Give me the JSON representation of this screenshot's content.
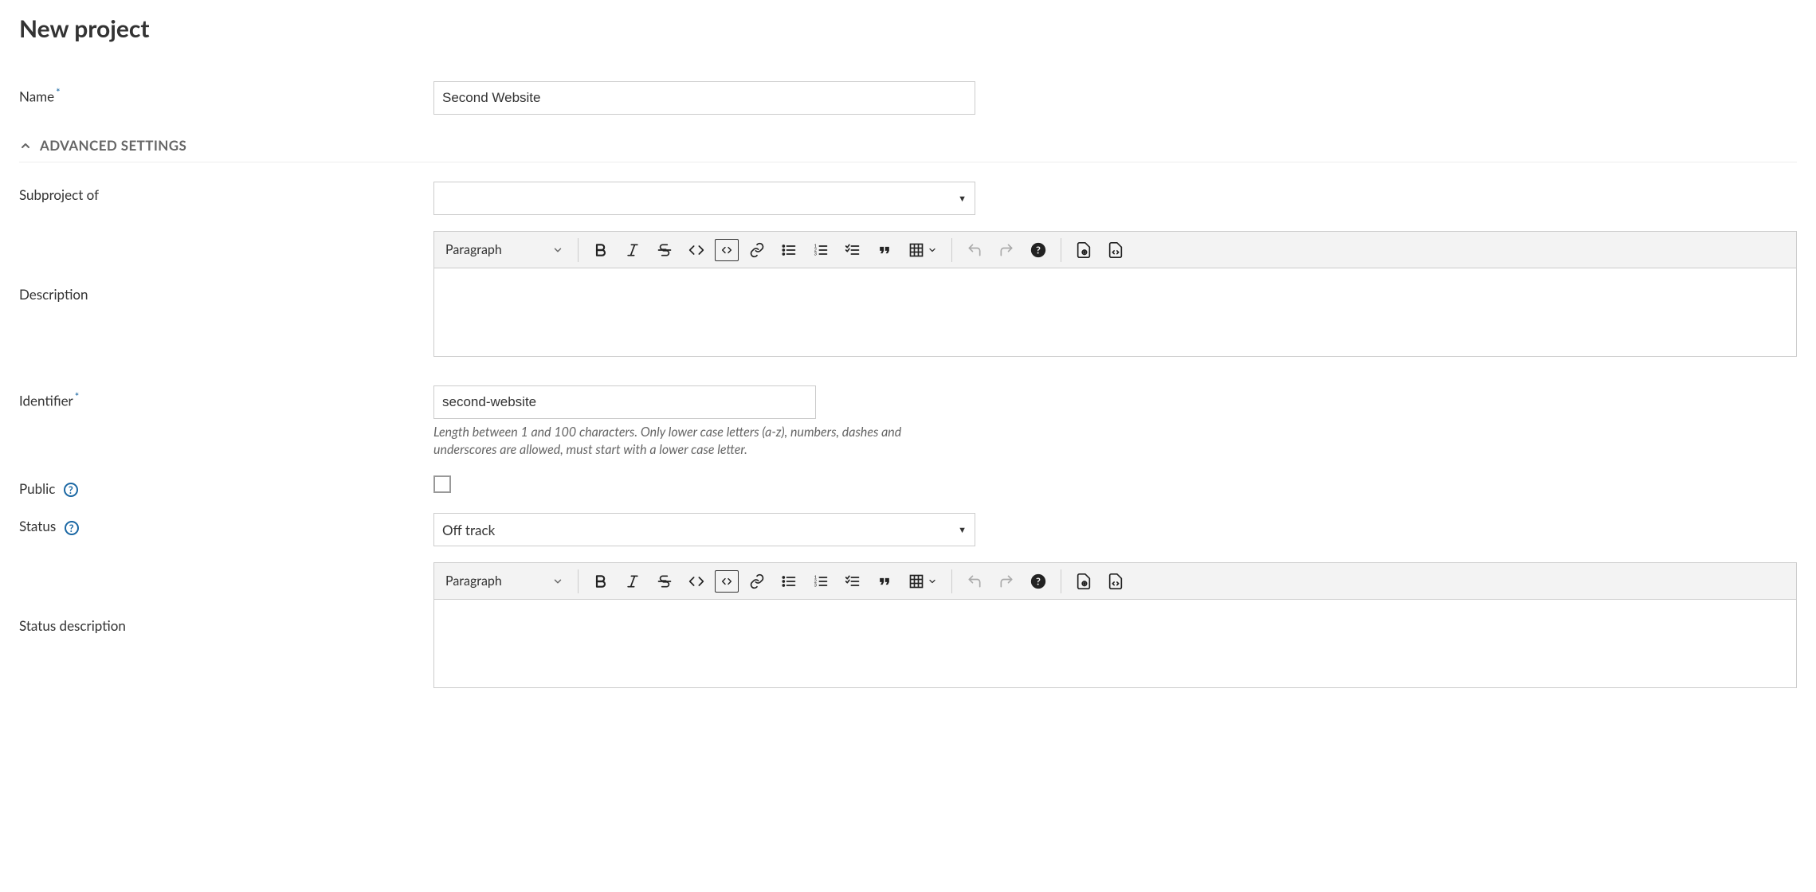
{
  "title": "New project",
  "labels": {
    "name": "Name",
    "advanced": "ADVANCED SETTINGS",
    "subproject": "Subproject of",
    "description": "Description",
    "identifier": "Identifier",
    "public": "Public",
    "status": "Status",
    "status_description": "Status description"
  },
  "values": {
    "name": "Second Website",
    "subproject": "",
    "identifier": "second-website",
    "public": false,
    "status": "Off track"
  },
  "hints": {
    "identifier": "Length between 1 and 100 characters. Only lower case letters (a-z), numbers, dashes and underscores are allowed, must start with a lower case letter."
  },
  "editor": {
    "paragraph": "Paragraph"
  }
}
